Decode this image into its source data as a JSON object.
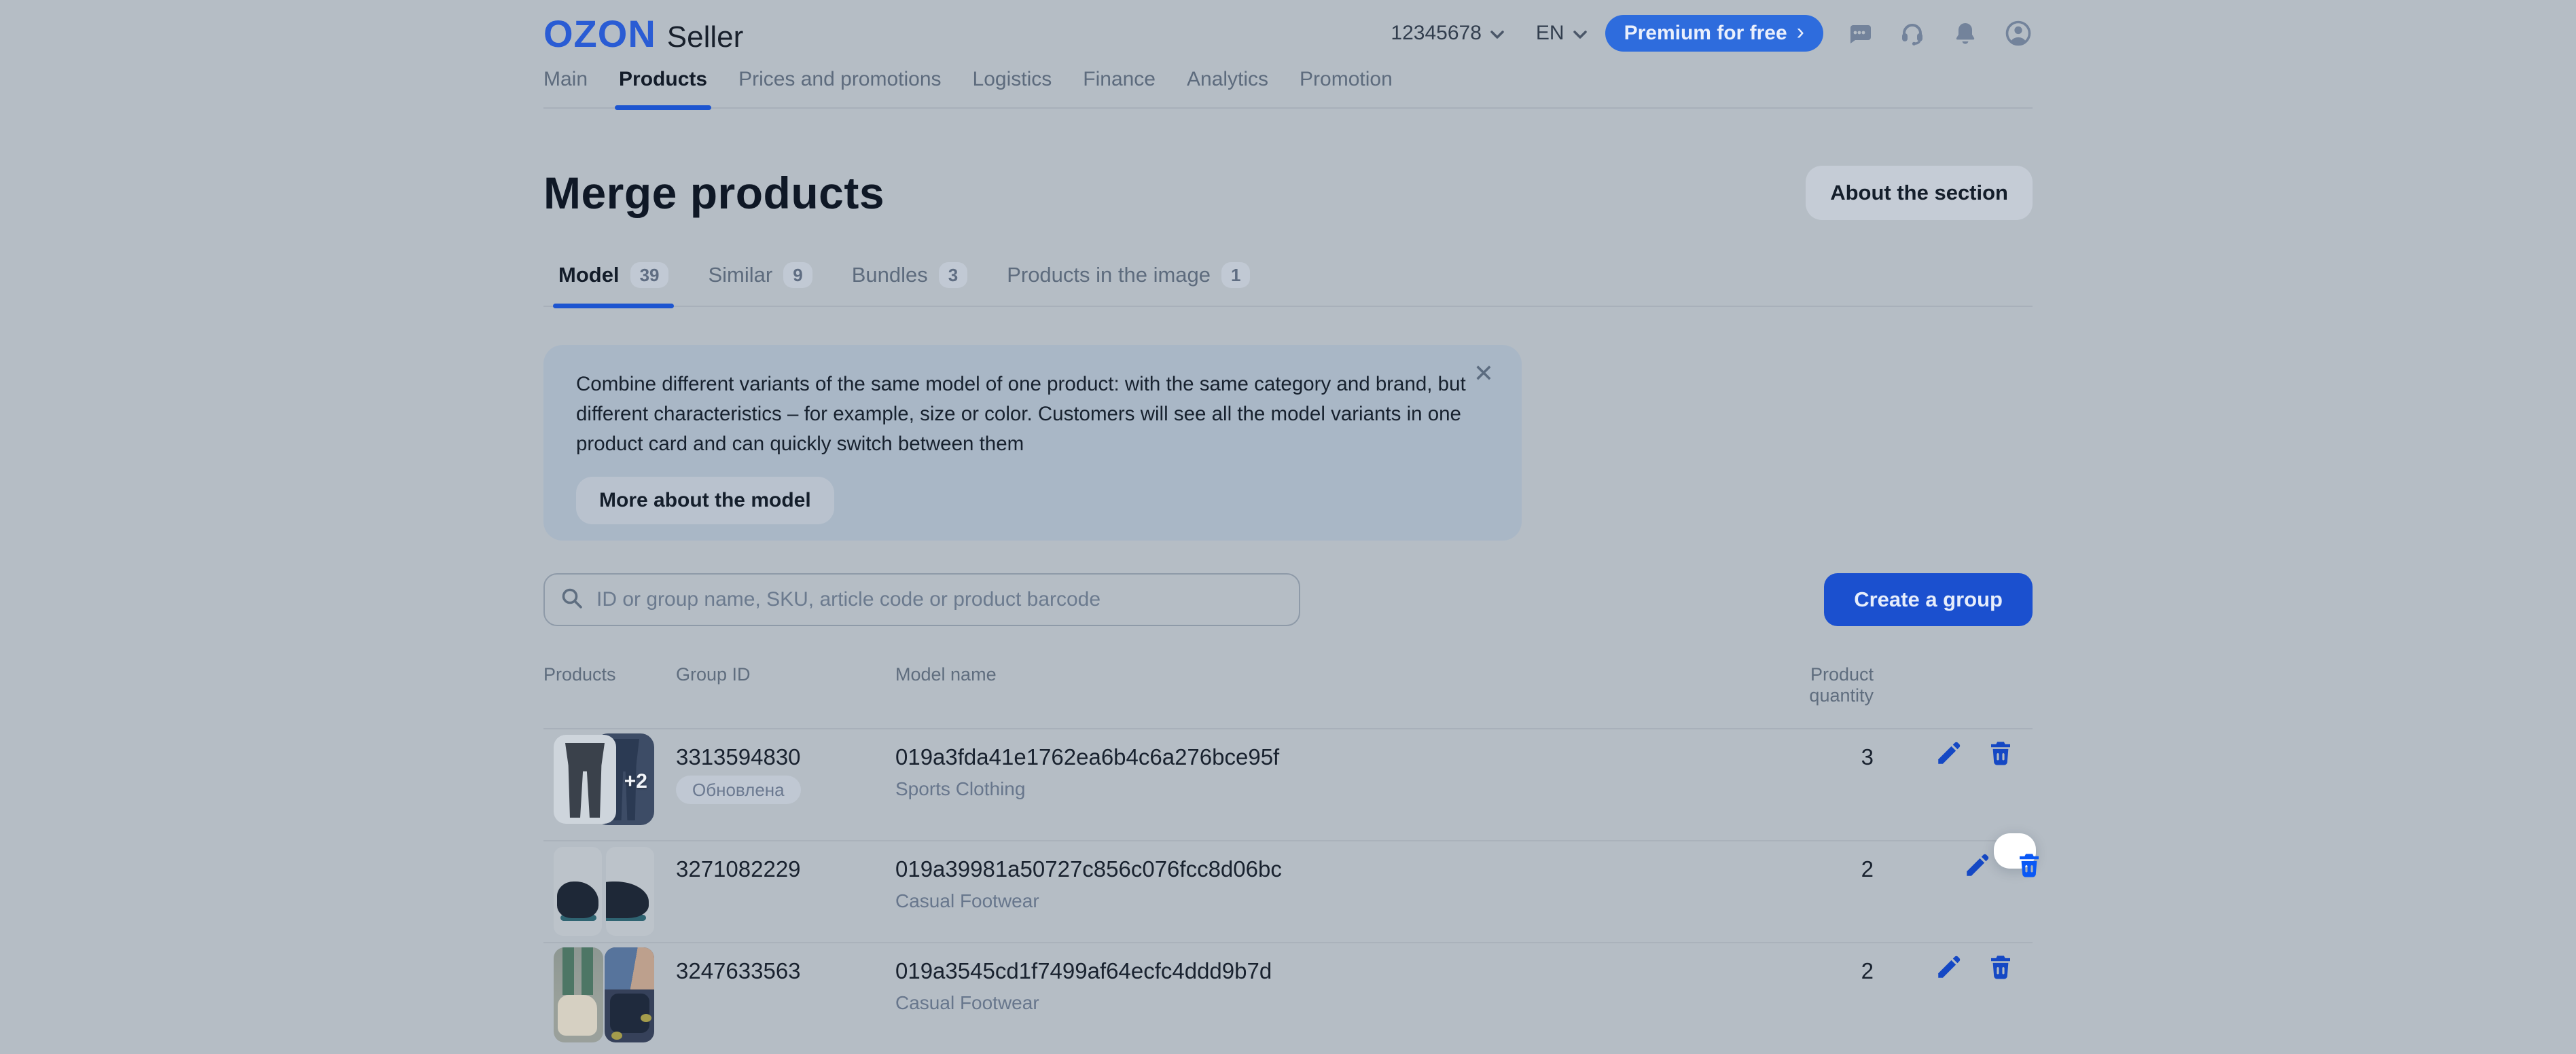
{
  "header": {
    "logo_brand": "OZON",
    "logo_suffix": "Seller",
    "account_id": "12345678",
    "language": "EN",
    "premium_button": "Premium for free",
    "premium_arrow": "›",
    "icon_names": [
      "chat-icon",
      "headset-icon",
      "bell-icon",
      "profile-icon"
    ]
  },
  "nav": {
    "items": [
      {
        "label": "Main",
        "active": false
      },
      {
        "label": "Products",
        "active": true
      },
      {
        "label": "Prices and promotions",
        "active": false
      },
      {
        "label": "Logistics",
        "active": false
      },
      {
        "label": "Finance",
        "active": false
      },
      {
        "label": "Analytics",
        "active": false
      },
      {
        "label": "Promotion",
        "active": false
      }
    ]
  },
  "page": {
    "title": "Merge products",
    "about_button": "About the section"
  },
  "tabs": [
    {
      "label": "Model",
      "count": "39",
      "active": true
    },
    {
      "label": "Similar",
      "count": "9",
      "active": false
    },
    {
      "label": "Bundles",
      "count": "3",
      "active": false
    },
    {
      "label": "Products in the image",
      "count": "1",
      "active": false
    }
  ],
  "banner": {
    "text": "Combine different variants of the same model of one product: with the same category and brand, but different characteristics – for example, size or color. Customers will see all the model variants in one product card and can quickly switch between them",
    "button": "More about the model",
    "close_glyph": "✕"
  },
  "toolbar": {
    "search_placeholder": "ID or group name, SKU, article code or product barcode",
    "create_button": "Create a group"
  },
  "table": {
    "columns": [
      "Products",
      "Group ID",
      "Model name",
      "Product quantity"
    ],
    "rows": [
      {
        "group_id": "3313594830",
        "status_badge": "Обновлена",
        "model_name": "019a3fda41e1762ea6b4c6a276bce95f",
        "category": "Sports Clothing",
        "quantity": "3",
        "thumb_extra_count": "+2"
      },
      {
        "group_id": "3271082229",
        "model_name": "019a39981a50727c856c076fcc8d06bc",
        "category": "Casual Footwear",
        "quantity": "2"
      },
      {
        "group_id": "3247633563",
        "model_name": "019a3545cd1f7499af64ecfc4ddd9b7d",
        "category": "Casual Footwear",
        "quantity": "2"
      }
    ]
  },
  "colors": {
    "accent_blue": "#005bff",
    "dimmed_accent": "#1b50cf",
    "page_dim_background": "#b5bdc5",
    "banner_background": "#a9b7c6",
    "spotlight_background": "#ffffff",
    "spotlight_icon": "#0a58f5"
  }
}
